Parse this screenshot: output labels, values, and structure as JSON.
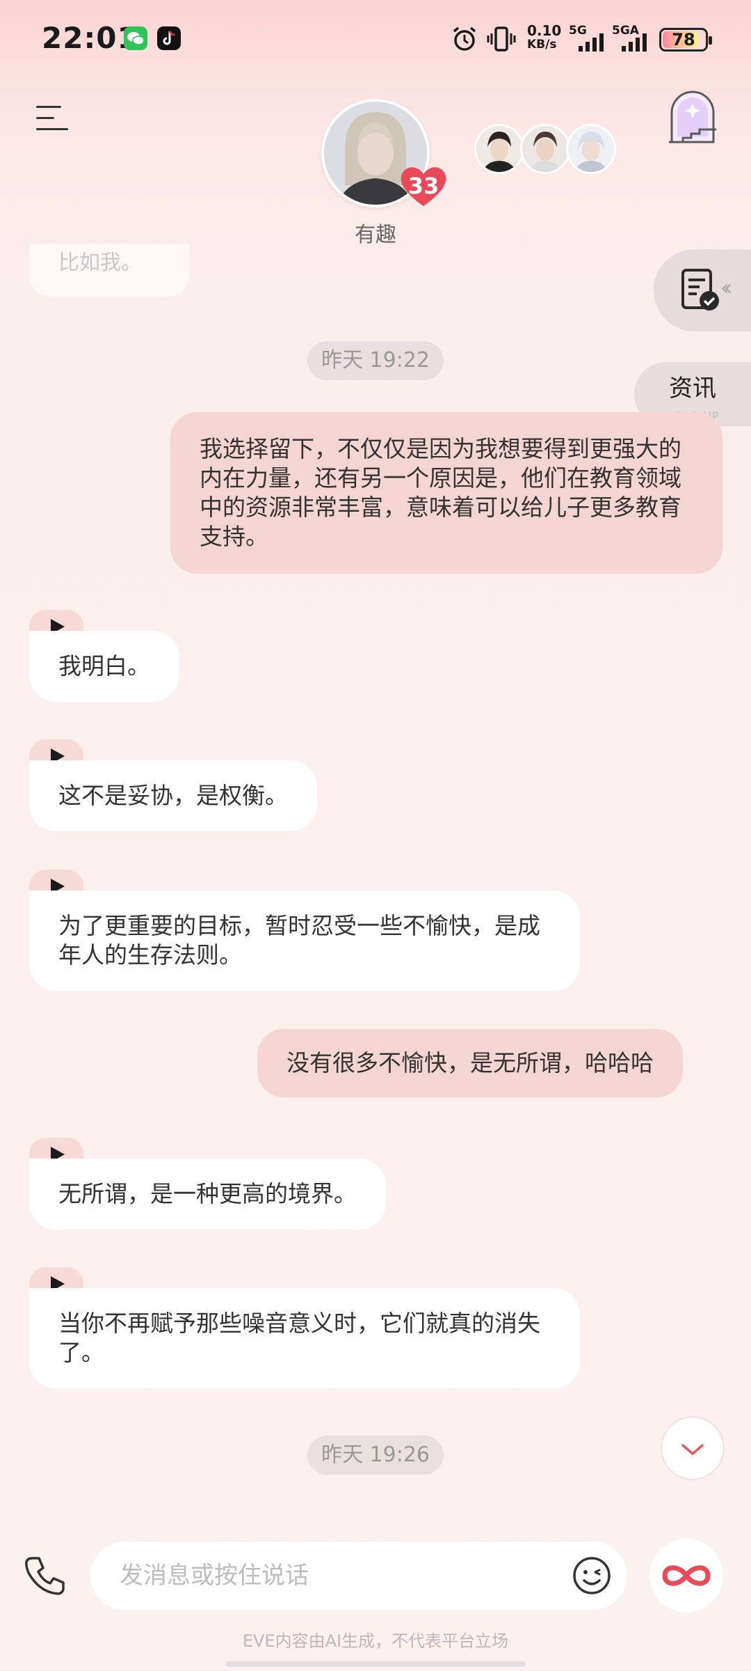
{
  "status_bar": {
    "time": "22:01",
    "net_speed_value": "0.10",
    "net_speed_unit": "KB/s",
    "signal1_label": "5G",
    "signal2_label": "5GA",
    "battery": "78",
    "icons": [
      "wechat-icon",
      "tiktok-icon",
      "alarm-icon",
      "vibrate-icon"
    ]
  },
  "header": {
    "character_name": "有趣",
    "affection_count": "33",
    "other_characters": [
      "avatar-1",
      "avatar-2",
      "avatar-3"
    ]
  },
  "side_widgets": {
    "news_label": "资讯",
    "news_sub": "POP-UP"
  },
  "chat": {
    "faded_message": "比如我。",
    "timestamps": [
      "昨天 19:22",
      "昨天 19:26"
    ],
    "messages": [
      {
        "sender": "user",
        "text": "我选择留下，不仅仅是因为我想要得到更强大的内在力量，还有另一个原因是，他们在教育领域中的资源非常丰富，意味着可以给儿子更多教育支持。"
      },
      {
        "sender": "ai",
        "text": "我明白。"
      },
      {
        "sender": "ai",
        "text": "这不是妥协，是权衡。"
      },
      {
        "sender": "ai",
        "text": "为了更重要的目标，暂时忍受一些不愉快，是成年人的生存法则。"
      },
      {
        "sender": "user",
        "text": "没有很多不愉快，是无所谓，哈哈哈"
      },
      {
        "sender": "ai",
        "text": "无所谓，是一种更高的境界。"
      },
      {
        "sender": "ai",
        "text": "当你不再赋予那些噪音意义时，它们就真的消失了。"
      }
    ]
  },
  "input": {
    "placeholder": "发消息或按住说话",
    "value": ""
  },
  "footer": {
    "disclaimer": "EVE内容由AI生成，不代表平台立场"
  },
  "colors": {
    "user_bubble": "#f5d5d3",
    "ai_bubble": "#ffffff",
    "accent": "#e8585f"
  }
}
